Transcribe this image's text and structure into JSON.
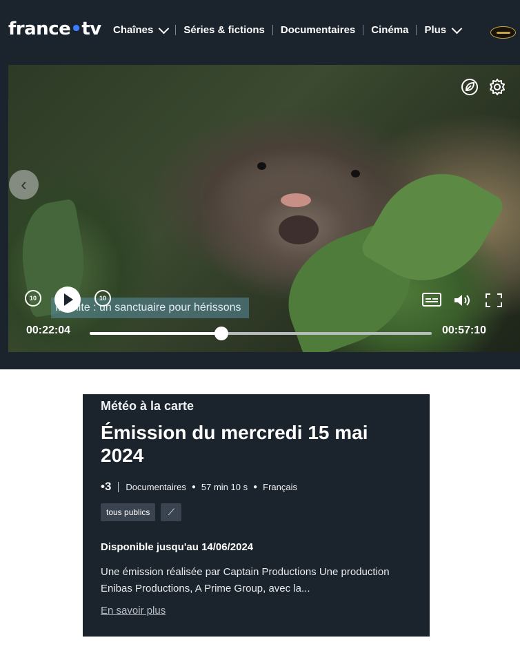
{
  "header": {
    "logo_main": "france",
    "logo_dot": "•",
    "logo_tv": "tv",
    "nav": [
      {
        "label": "Chaînes",
        "dropdown": true
      },
      {
        "label": "Séries & fictions",
        "dropdown": false
      },
      {
        "label": "Documentaires",
        "dropdown": false
      },
      {
        "label": "Cinéma",
        "dropdown": false
      },
      {
        "label": "Plus",
        "dropdown": true
      }
    ]
  },
  "player": {
    "caption_brand": "MÉTÉO\nà la\nCARTE",
    "caption_text": "Insolite : un sanctuaire pour hérissons",
    "skip_back_label": "10",
    "skip_forward_label": "10",
    "current_time": "00:22:04",
    "duration": "00:57:10",
    "progress": 0.386,
    "icons": [
      "eco-leaf-icon",
      "settings-gear-icon",
      "subtitles-icon",
      "volume-icon",
      "fullscreen-icon"
    ]
  },
  "program": {
    "kicker": "Météo à la carte",
    "title": "Émission du mercredi 15 mai 2024",
    "channel": "•3",
    "genre": "Documentaires",
    "duration": "57 min 10 s",
    "language": "Français",
    "tags": [
      "tous publics"
    ],
    "availability": "Disponible jusqu'au 14/06/2024",
    "description": "Une émission réalisée par Captain Productions Une production Enibas Productions, A Prime Group, avec la...",
    "more_link": "En savoir plus"
  }
}
